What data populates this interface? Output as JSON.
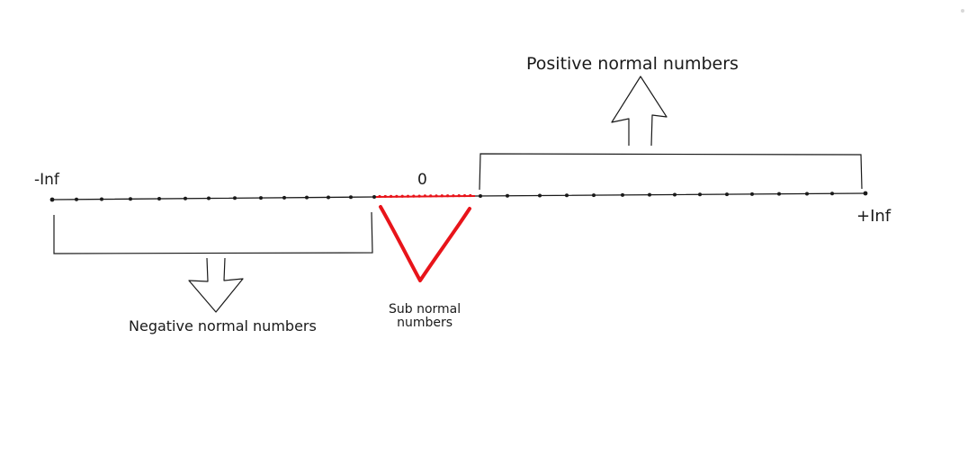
{
  "labels": {
    "neg_inf": "-Inf",
    "zero": "0",
    "pos_inf": "+Inf",
    "positive_normal": "Positive normal numbers",
    "negative_normal": "Negative normal numbers",
    "subnormal_line1": "Sub normal",
    "subnormal_line2": "numbers"
  },
  "colors": {
    "line": "#1a1a1a",
    "subnormal": "#e8141a"
  }
}
